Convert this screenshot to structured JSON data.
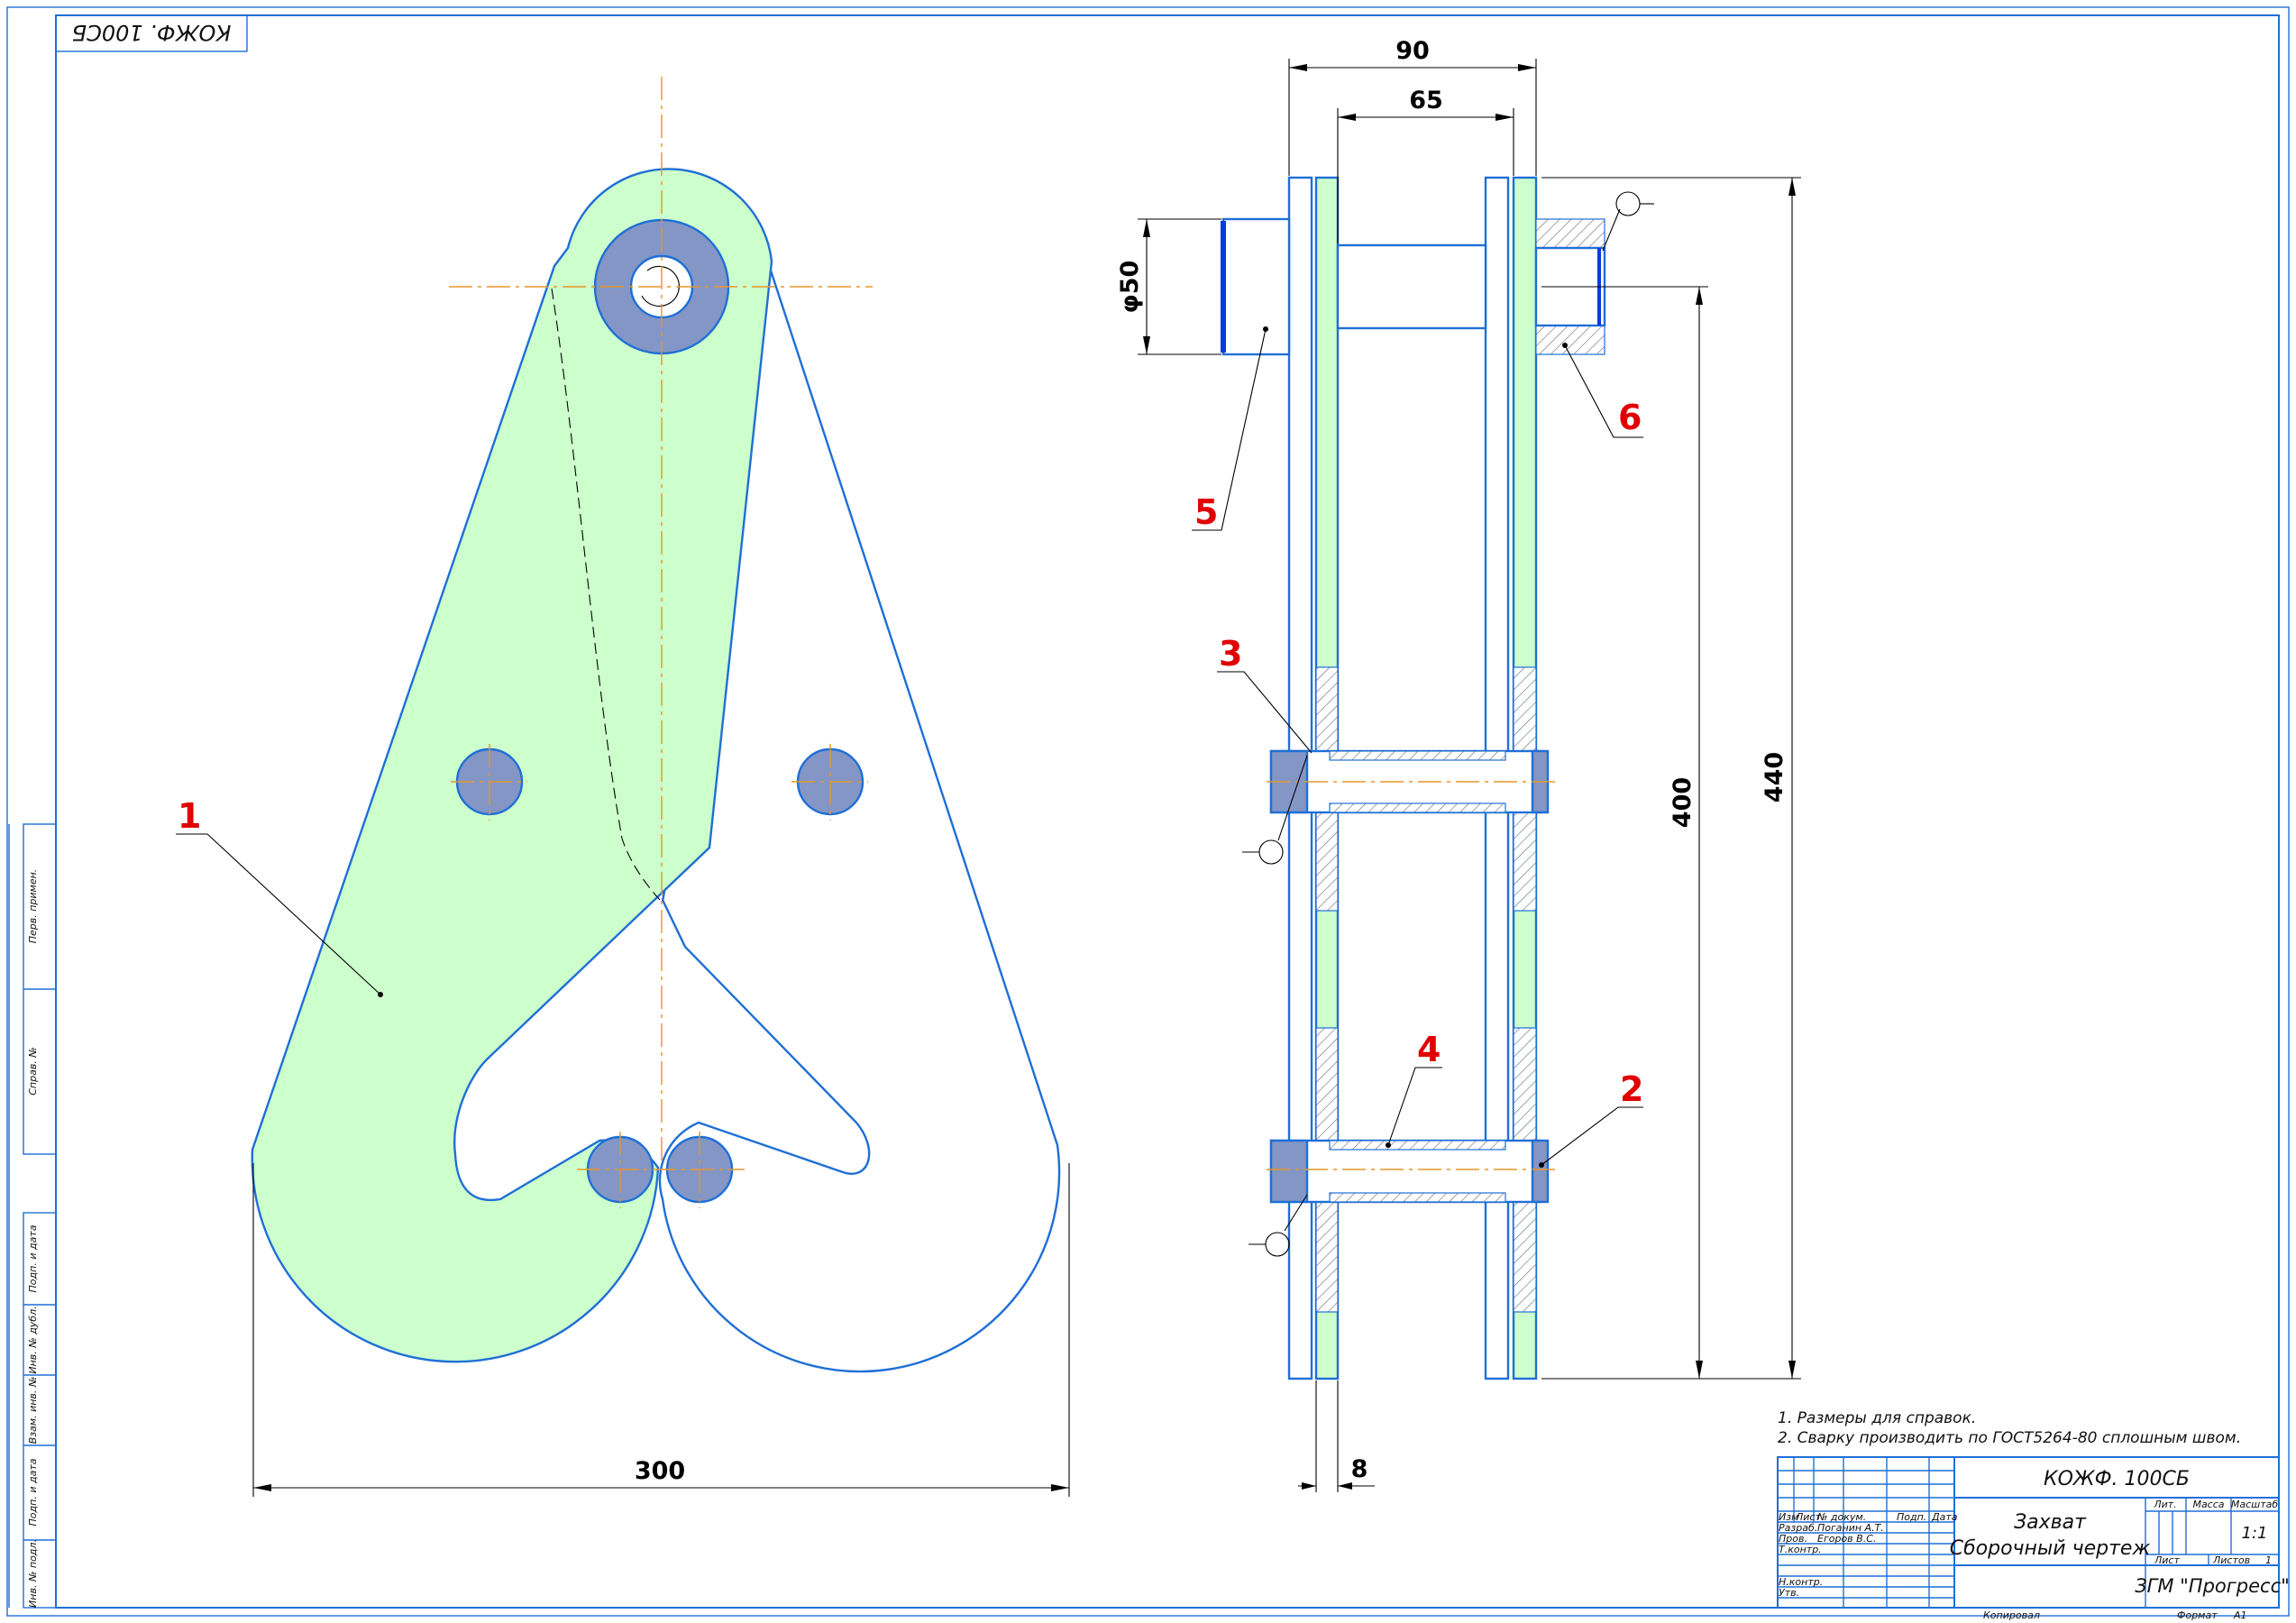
{
  "stamp_top": "КОЖФ. 100СБ",
  "dimensions": {
    "width_300": "300",
    "d90": "90",
    "d65": "65",
    "phi50": "φ50",
    "h400": "400",
    "h440": "440",
    "t8": "8"
  },
  "positions": [
    "1",
    "2",
    "3",
    "4",
    "5",
    "6"
  ],
  "notes": [
    "1. Размеры для справок.",
    "2. Сварку производить по ГОСТ5264-80 сплошным швом."
  ],
  "side_labels": [
    "Перв. примен.",
    "Справ. №",
    "Подп. и дата",
    "Инв. № дубл.",
    "Взам. инв. №",
    "Подп. и дата",
    "Инв. № подл."
  ],
  "title_block": {
    "designation": "КОЖФ. 100СБ",
    "name_line1": "Захват",
    "name_line2": "Сборочный чертеж",
    "col_lit": "Лит.",
    "col_mass": "Масса",
    "col_scale": "Масштаб",
    "scale": "1:1",
    "sheet": "Лист",
    "sheets": "Листов",
    "sheets_count": "1",
    "company": "ЗГМ \"Прогресс\"",
    "headers": [
      "Изм",
      "Лист",
      "№ докум.",
      "Подп.",
      "Дата"
    ],
    "row_labels": [
      "Разраб.",
      "Пров.",
      "Т.контр.",
      "Н.контр.",
      "Утв."
    ],
    "developer": "Поганин А.Т.",
    "checker": "Егоров В.С.",
    "copied": "Копировал",
    "format": "Формат",
    "format_value": "А1"
  }
}
